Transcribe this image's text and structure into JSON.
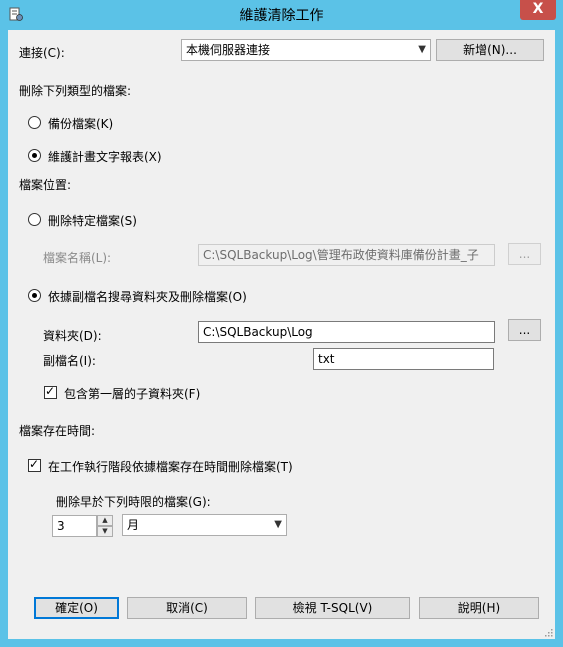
{
  "window": {
    "title": "維護清除工作",
    "close_glyph": "X"
  },
  "connection": {
    "label": "連接(C):",
    "value": "本機伺服器連接",
    "new_button": "新增(N)..."
  },
  "file_type": {
    "heading": "刪除下列類型的檔案:",
    "options": [
      "備份檔案(K)",
      "維護計畫文字報表(X)"
    ],
    "selected": 1
  },
  "file_location": {
    "heading": "檔案位置:",
    "delete_specific_label": "刪除特定檔案(S)",
    "file_name_label": "檔案名稱(L):",
    "file_name_value": "C:\\SQLBackup\\Log\\管理布政使資料庫備份計畫_子計畫",
    "browse_button": "...",
    "search_by_ext_label": "依據副檔名搜尋資料夾及刪除檔案(O)",
    "folder_label": "資料夾(D):",
    "folder_value": "C:\\SQLBackup\\Log",
    "folder_browse_button": "...",
    "extension_label": "副檔名(I):",
    "extension_value": "txt",
    "include_subfolders_label": "包含第一層的子資料夾(F)"
  },
  "file_age": {
    "heading": "檔案存在時間:",
    "delete_by_age_label": "在工作執行階段依據檔案存在時間刪除檔案(T)",
    "older_than_label": "刪除早於下列時限的檔案(G):",
    "amount": "3",
    "unit": "月"
  },
  "footer": {
    "ok": "確定(O)",
    "cancel": "取消(C)",
    "view_tsql": "檢視 T-SQL(V)",
    "help": "說明(H)"
  }
}
